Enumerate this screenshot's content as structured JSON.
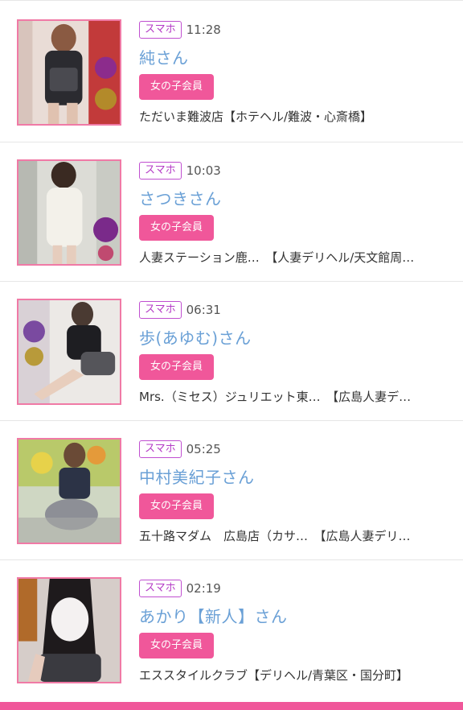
{
  "colors": {
    "accent_pink": "#f0579a",
    "device_tag": "#b43cc6",
    "name_blue": "#6aa0d6"
  },
  "entries": [
    {
      "device": "スマホ",
      "time": "11:28",
      "name": "純さん",
      "badge": "女の子会員",
      "shop": "ただいま難波店【ホテヘル/難波・心斎橋】",
      "photo": "photo-1"
    },
    {
      "device": "スマホ",
      "time": "10:03",
      "name": "さつきさん",
      "badge": "女の子会員",
      "shop": "人妻ステーション鹿…　【人妻デリヘル/天文館周…",
      "photo": "photo-2"
    },
    {
      "device": "スマホ",
      "time": "06:31",
      "name": "歩(あゆむ)さん",
      "badge": "女の子会員",
      "shop": "Mrs.（ミセス）ジュリエット東…　【広島人妻デ…",
      "photo": "photo-3"
    },
    {
      "device": "スマホ",
      "time": "05:25",
      "name": "中村美紀子さん",
      "badge": "女の子会員",
      "shop": "五十路マダム　広島店（カサ…　【広島人妻デリ…",
      "photo": "photo-4"
    },
    {
      "device": "スマホ",
      "time": "02:19",
      "name": "あかり【新人】さん",
      "badge": "女の子会員",
      "shop": "エススタイルクラブ【デリヘル/青葉区・国分町】",
      "photo": "photo-5"
    }
  ]
}
